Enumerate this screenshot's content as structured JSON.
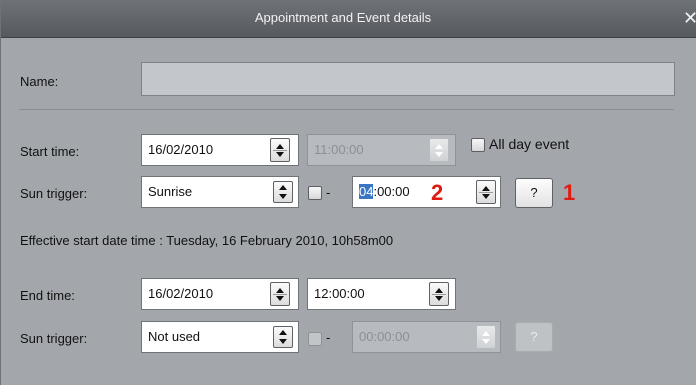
{
  "window": {
    "title": "Appointment and Event details",
    "close_glyph": "✕"
  },
  "name": {
    "label": "Name:",
    "value": ""
  },
  "start": {
    "label": "Start time:",
    "date": "16/02/2010",
    "time": "11:00:00",
    "all_day_label": "All day event",
    "all_day_checked": false,
    "sun_trigger_label": "Sun trigger:",
    "sun_trigger_value": "Sunrise",
    "offset_sign": "-",
    "offset_checked": false,
    "offset_hours_selected": "04",
    "offset_rest": ":00:00",
    "help_label": "?",
    "effective_text": "Effective start date time : Tuesday, 16 February 2010, 10h58m00"
  },
  "end": {
    "label": "End time:",
    "date": "16/02/2010",
    "time": "12:00:00",
    "sun_trigger_label": "Sun trigger:",
    "sun_trigger_value": "Not used",
    "offset_sign": "-",
    "offset_checked": false,
    "offset_value": "00:00:00",
    "help_label": "?"
  },
  "annotations": {
    "marker_1": "1",
    "marker_2": "2",
    "color": "#e11b12"
  }
}
